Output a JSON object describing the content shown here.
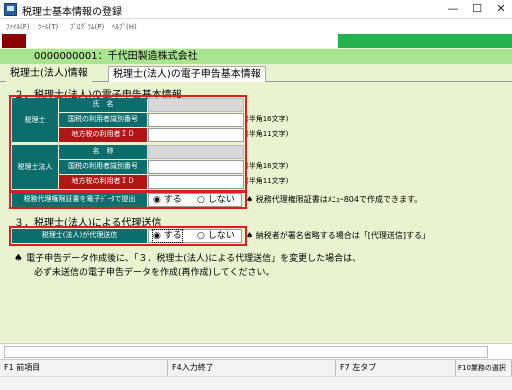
{
  "window": {
    "title": "税理士基本情報の登録",
    "minimize": "—",
    "maximize": "☐",
    "close": "✕"
  },
  "menu": {
    "file": "ﾌｧｲﾙ(F)",
    "tool": "ﾂｰﾙ(T)",
    "program": "ﾌﾟﾛｸﾞﾗﾑ(P)",
    "help": "ﾍﾙﾌﾟ(H)"
  },
  "company": {
    "name": "0000000001：千代田製造株式会社"
  },
  "tabs": [
    {
      "label": "税理士(法人)情報"
    },
    {
      "label": "税理士(法人)の電子申告基本情報"
    }
  ],
  "section2": {
    "title": "２．税理士(法人)の電子申告基本情報",
    "zeirishi_label": "税理士",
    "houjin_label": "税理士法人",
    "rows": [
      {
        "label": "氏　名",
        "hint": ""
      },
      {
        "label": "国税の利用者識別番号",
        "hint": "(半角16文字)"
      },
      {
        "label": "地方税の利用者ＩＤ",
        "hint": "(半角11文字)"
      },
      {
        "label": "名　称",
        "hint": ""
      },
      {
        "label": "国税の利用者識別番号",
        "hint": "(半角16文字)"
      },
      {
        "label": "地方税の利用者ＩＤ",
        "hint": "(半角11文字)"
      }
    ],
    "proxy_cert_label": "税務代理権限証書を電子ﾃﾞｰﾀで提出",
    "proxy_cert_yes": "◉ する",
    "proxy_cert_no": "○ しない",
    "proxy_cert_note": "税務代理権限証書はﾒﾆｭｰ804で作成できます。"
  },
  "section3": {
    "title": "３．税理士(法人)による代理送信",
    "label": "税理士(法人)が代理送信",
    "yes": "◉ する",
    "no": "○ しない",
    "note": "納税者が署名省略する場合は「[代理送信]する」"
  },
  "notice": {
    "line1": "電子申告データ作成後に、「３．税理士(法人)による代理送信」を変更した場合は、",
    "line2": "必ず未送信の電子申告データを作成(再作成)してください。"
  },
  "fkeys": {
    "f1": "F1 前項目",
    "f4": "F4入力終了",
    "f7": "F7 左タブ",
    "f10": "F10業務の選択"
  },
  "colors": {
    "accent_dark": "#0d6d6d",
    "accent_red": "#b01616",
    "highlight_outline": "#e01c1c",
    "company_bar": "#a8e58f",
    "background": "#e9f3cf"
  }
}
